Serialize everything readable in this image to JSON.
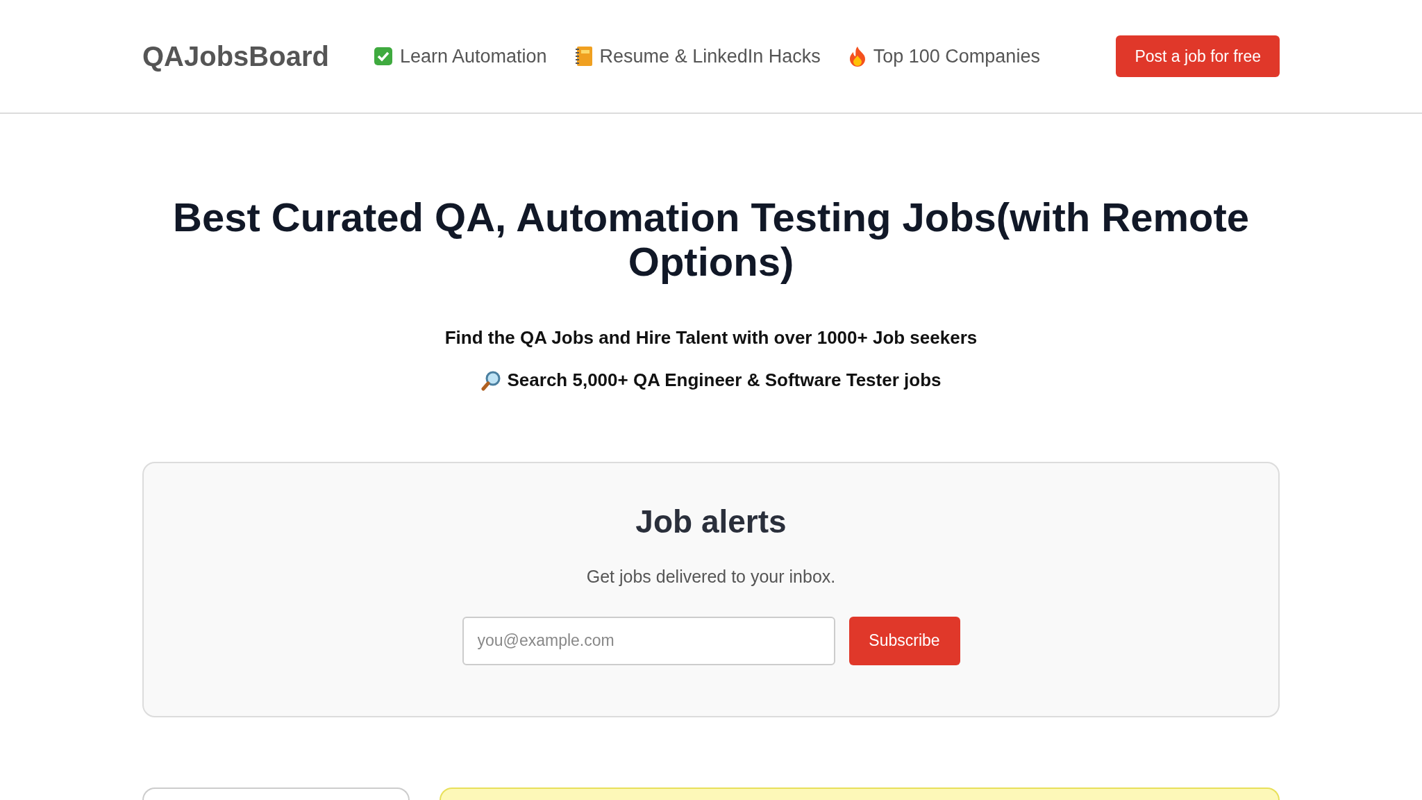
{
  "header": {
    "logo": "QAJobsBoard",
    "nav": [
      {
        "kind": "check",
        "label": "Learn Automation"
      },
      {
        "kind": "notebook",
        "label": "Resume & LinkedIn Hacks"
      },
      {
        "kind": "flame",
        "label": "Top 100 Companies"
      }
    ],
    "cta": "Post a job for free"
  },
  "hero": {
    "title": "Best **Curated QA, Automation Testing** Jobs(with Remote Options)",
    "lines": [
      {
        "kind": "plain",
        "text": "Find the QA Jobs and Hire Talent with over 1000+ Job seekers"
      },
      {
        "kind": "search",
        "text": "Search 5,000+ QA Engineer & Software Tester jobs"
      }
    ]
  },
  "job_alerts": {
    "title": "Job alerts",
    "subtitle": "Get jobs delivered to your inbox.",
    "email": {
      "placeholder": "you@example.com"
    },
    "button": "Subscribe"
  }
}
